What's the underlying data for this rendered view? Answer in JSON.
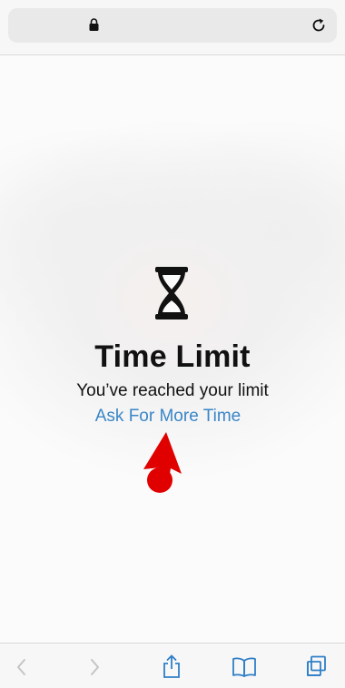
{
  "toolbar_top": {
    "lock_icon": "lock-icon",
    "reload_icon": "reload-icon"
  },
  "content": {
    "title": "Time Limit",
    "subtitle": "You’ve reached your limit",
    "ask_link": "Ask For More Time",
    "icon": "hourglass-icon"
  },
  "annotation": {
    "color": "#e00000",
    "icon": "red-arrow-icon"
  },
  "toolbar_bottom": {
    "back_icon": "chevron-left-icon",
    "forward_icon": "chevron-right-icon",
    "share_icon": "share-icon",
    "bookmarks_icon": "book-icon",
    "tabs_icon": "tabs-icon"
  },
  "colors": {
    "link": "#3a86c8",
    "toolbar_icon": "#2f7fc7",
    "disabled_icon": "#c4c4c6"
  }
}
